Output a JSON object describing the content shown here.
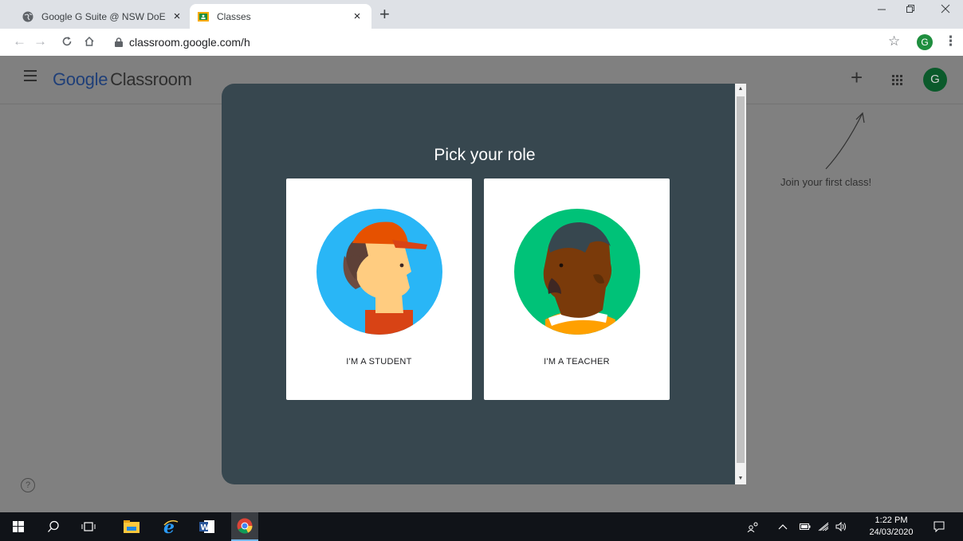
{
  "browser": {
    "tabs": [
      {
        "title": "Google G Suite @ NSW DoE",
        "close": "×"
      },
      {
        "title": "Classes",
        "close": "×"
      }
    ],
    "new_tab": "+",
    "url": "classroom.google.com/h",
    "profile_initial": "G"
  },
  "app": {
    "brand_google": "Google",
    "brand_product": "Classroom",
    "add_label": "+",
    "avatar_initial": "G",
    "join_hint": "Join your first class!",
    "help": "?"
  },
  "modal": {
    "title": "Pick your role",
    "student_label": "I'M A STUDENT",
    "teacher_label": "I'M A TEACHER"
  },
  "taskbar": {
    "time": "1:22 PM",
    "date": "24/03/2020"
  }
}
